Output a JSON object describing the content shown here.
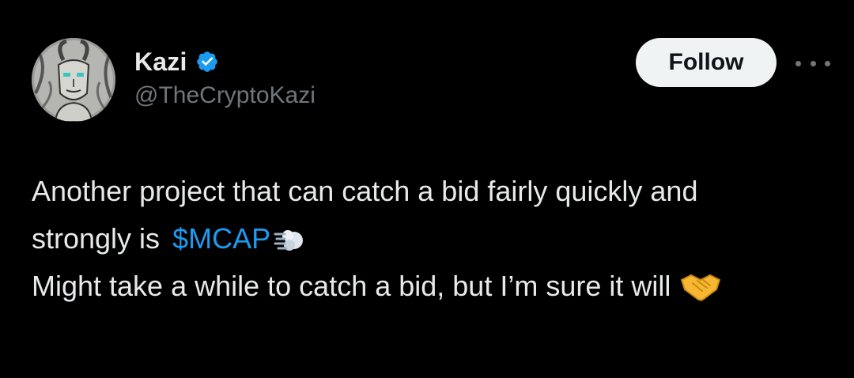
{
  "author": {
    "display_name": "Kazi",
    "handle": "@TheCryptoKazi",
    "verified": true,
    "avatar_icon": "robot-goat-avatar",
    "verified_icon": "verified-badge-icon"
  },
  "actions": {
    "follow_label": "Follow",
    "more_icon": "more-options-icon"
  },
  "tweet": {
    "line1": "Another project that can catch a bid fairly quickly and",
    "line2_prefix": "strongly is",
    "cashtag": "$MCAP",
    "line2_emoji": "dashing-away-emoji",
    "line3": "Might take a while to catch a bid, but I’m sure it will",
    "line3_emoji": "handshake-emoji"
  },
  "colors": {
    "background": "#000000",
    "text": "#e7e9ea",
    "secondary_text": "#71767b",
    "link": "#1d9bf0",
    "verified": "#1d9bf0",
    "follow_bg": "#eff3f4"
  }
}
